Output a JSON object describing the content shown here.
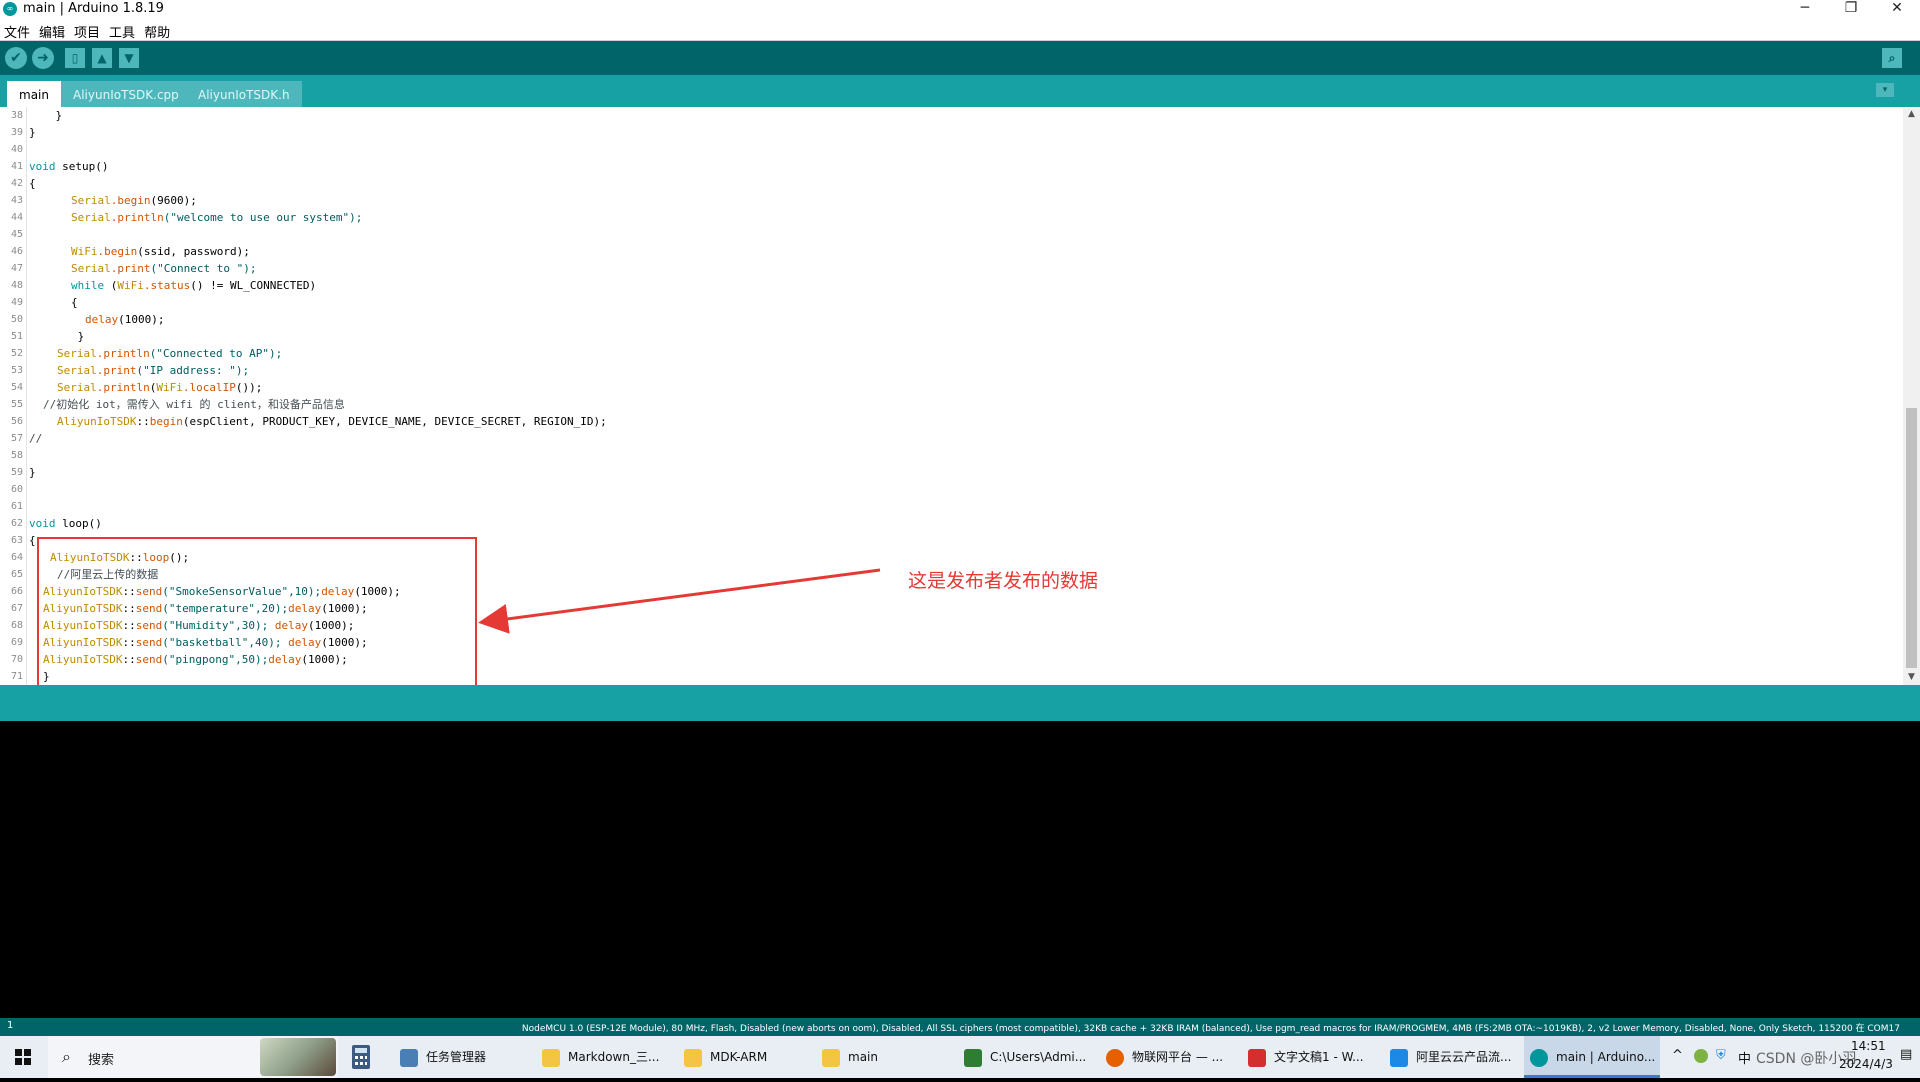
{
  "window": {
    "title": "main | Arduino 1.8.19",
    "icon": "arduino-icon",
    "minimize": "─",
    "restore": "❐",
    "close": "✕"
  },
  "menu": [
    "文件",
    "编辑",
    "项目",
    "工具",
    "帮助"
  ],
  "toolbar": {
    "verify": "✔",
    "upload": "➜",
    "new": "▯",
    "open": "▲",
    "save": "▼",
    "serial_monitor": "⌕"
  },
  "tabs": [
    {
      "label": "main",
      "active": true
    },
    {
      "label": "AliyunIoTSDK.cpp",
      "active": false
    },
    {
      "label": "AliyunIoTSDK.h",
      "active": false
    }
  ],
  "tab_menu_icon": "▾",
  "line_numbers": [
    "38",
    "39",
    "40",
    "41",
    "42",
    "43",
    "44",
    "45",
    "46",
    "47",
    "48",
    "49",
    "50",
    "51",
    "52",
    "53",
    "54",
    "55",
    "56",
    "57",
    "58",
    "59",
    "60",
    "61",
    "62",
    "63",
    "64",
    "65",
    "66",
    "67",
    "68",
    "69",
    "70",
    "71"
  ],
  "code": {
    "l38": "    }",
    "l39": "}",
    "l41_kw": "void",
    "l41_rest": " setup()",
    "l42": "{",
    "l43_cls": "Serial",
    "l43_fn": ".begin",
    "l43_rest": "(9600);",
    "l44_cls": "Serial",
    "l44_fn": ".println",
    "l44_str": "(\"welcome to use our system\");",
    "l46_cls": "WiFi",
    "l46_fn": ".begin",
    "l46_rest": "(ssid, password);",
    "l47_cls": "Serial",
    "l47_fn": ".print",
    "l47_str": "(\"Connect to \");",
    "l48_kw": "while",
    "l48_a": " (",
    "l48_cls": "WiFi",
    "l48_fn": ".status",
    "l48_b": "() != WL_CONNECTED)",
    "l49": "{",
    "l50_fn": "delay",
    "l50_rest": "(1000);",
    "l51": " }",
    "l52_cls": "Serial",
    "l52_fn": ".println",
    "l52_str": "(\"Connected to AP\");",
    "l53_cls": "Serial",
    "l53_fn": ".print",
    "l53_str": "(\"IP address: \");",
    "l54_cls": "Serial",
    "l54_fn": ".println",
    "l54_a": "(",
    "l54_cls2": "WiFi",
    "l54_fn2": ".localIP",
    "l54_b": "());",
    "l55_cm": "//初始化 iot，需传入 wifi 的 client，和设备产品信息",
    "l56_cls": "AliyunIoTSDK",
    "l56_a": "::",
    "l56_fn": "begin",
    "l56_rest": "(espClient, PRODUCT_KEY, DEVICE_NAME, DEVICE_SECRET, REGION_ID);",
    "l57_cm": "//",
    "l59": "}",
    "l62_kw": "void",
    "l62_rest": " loop()",
    "l63": "{",
    "l64_cls": "AliyunIoTSDK",
    "l64_a": "::",
    "l64_fn": "loop",
    "l64_rest": "();",
    "l65_cm": "//阿里云上传的数据",
    "l66_cls": "AliyunIoTSDK",
    "l66_a": "::",
    "l66_fn": "send",
    "l66_str": "(\"SmokeSensorValue\",10);",
    "l66_fn2": "delay",
    "l66_rest": "(1000);",
    "l67_cls": "AliyunIoTSDK",
    "l67_a": "::",
    "l67_fn": "send",
    "l67_str": "(\"temperature\",20);",
    "l67_fn2": "delay",
    "l67_rest": "(1000);",
    "l68_cls": "AliyunIoTSDK",
    "l68_a": "::",
    "l68_fn": "send",
    "l68_str": "(\"Humidity\",30); ",
    "l68_fn2": "delay",
    "l68_rest": "(1000);",
    "l69_cls": "AliyunIoTSDK",
    "l69_a": "::",
    "l69_fn": "send",
    "l69_str": "(\"basketball\",40); ",
    "l69_fn2": "delay",
    "l69_rest": "(1000);",
    "l70_cls": "AliyunIoTSDK",
    "l70_a": "::",
    "l70_fn": "send",
    "l70_str": "(\"pingpong\",50);",
    "l70_fn2": "delay",
    "l70_rest": "(1000);",
    "l71": "}"
  },
  "annotation": {
    "text": "这是发布者发布的数据",
    "color": "#e53935"
  },
  "footer": {
    "line": "1",
    "board": "NodeMCU 1.0 (ESP-12E Module), 80 MHz, Flash, Disabled (new aborts on oom), Disabled, All SSL ciphers (most compatible), 32KB cache + 32KB IRAM (balanced), Use pgm_read macros for IRAM/PROGMEM, 4MB (FS:2MB OTA:~1019KB), 2, v2 Lower Memory, Disabled, None, Only Sketch, 115200 在 COM17"
  },
  "taskbar": {
    "search_label": "搜索",
    "tasks": [
      {
        "label": "任务管理器",
        "icon": "task-manager-icon",
        "color": "#4a7fb5"
      },
      {
        "label": "Markdown_三...",
        "icon": "folder-icon",
        "color": "#f4c542"
      },
      {
        "label": "MDK-ARM",
        "icon": "folder-icon",
        "color": "#f4c542"
      },
      {
        "label": "main",
        "icon": "folder-icon",
        "color": "#f4c542"
      },
      {
        "label": "C:\\Users\\Admi...",
        "icon": "terminal-icon",
        "color": "#2e7d32"
      },
      {
        "label": "物联网平台 — ...",
        "icon": "firefox-icon",
        "color": "#e66000"
      },
      {
        "label": "文字文稿1 - W...",
        "icon": "wps-icon",
        "color": "#d32f2f"
      },
      {
        "label": "阿里云云产品流...",
        "icon": "vscode-icon",
        "color": "#1e88e5"
      },
      {
        "label": "main | Arduino...",
        "icon": "arduino-icon",
        "color": "#00979c"
      }
    ],
    "tray_chevron": "^",
    "ime": "中",
    "time": "14:51",
    "date": "2024/4/3",
    "watermark": "CSDN @卧小羽"
  },
  "colors": {
    "toolbar": "#006468",
    "tabbar": "#17a1a5",
    "annotation": "#e53935"
  }
}
